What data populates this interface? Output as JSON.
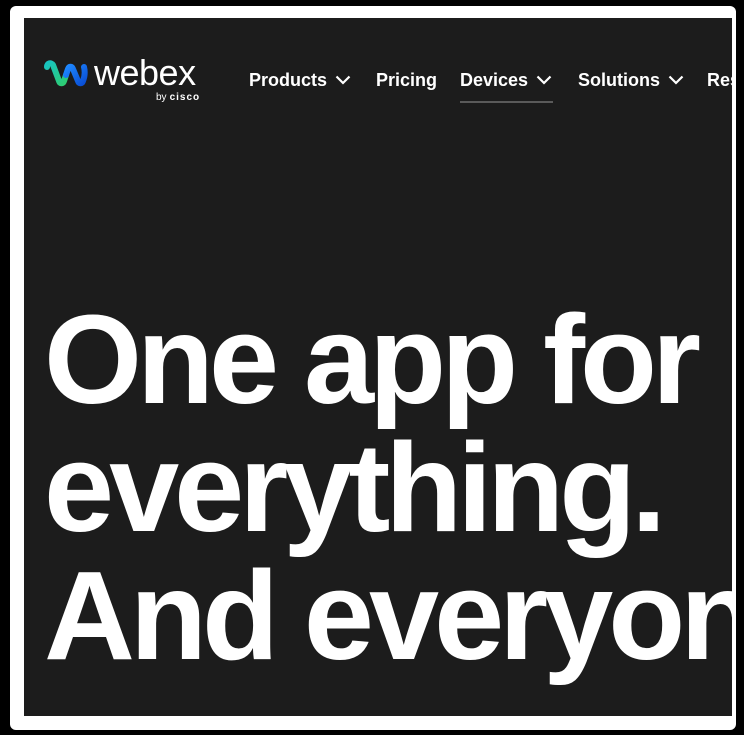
{
  "brand": {
    "wordmark": "webex",
    "by": "by",
    "parent": "cisco",
    "colors": {
      "blue": "#1e88ff",
      "green": "#2ecc71",
      "teal": "#00a0d2"
    }
  },
  "nav": {
    "items": [
      {
        "label": "Products",
        "has_dropdown": true
      },
      {
        "label": "Pricing",
        "has_dropdown": false
      },
      {
        "label": "Devices",
        "has_dropdown": true,
        "active": true
      },
      {
        "label": "Solutions",
        "has_dropdown": true
      },
      {
        "label": "Res",
        "has_dropdown": false
      }
    ]
  },
  "hero": {
    "lines": [
      "One app for",
      "everything.",
      "And everyon"
    ]
  },
  "colors": {
    "background": "#1c1c1c",
    "text": "#ffffff",
    "frame": "#ffffff"
  }
}
